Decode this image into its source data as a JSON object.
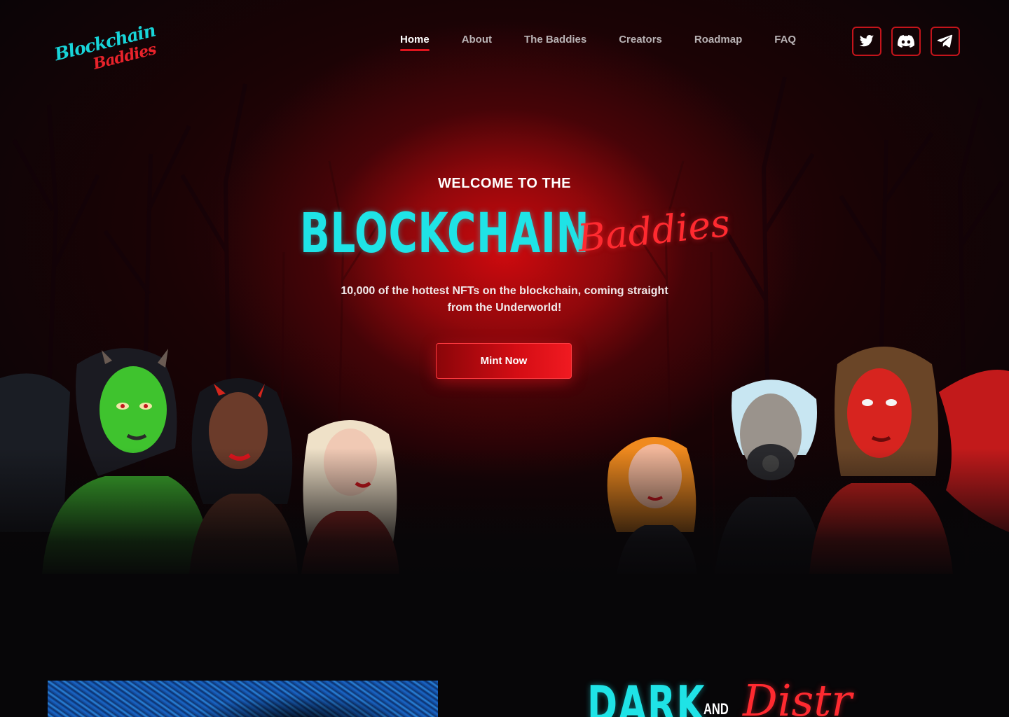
{
  "brand": {
    "logo_line1": "Blockchain",
    "logo_line2": "Baddies"
  },
  "nav": {
    "items": [
      {
        "label": "Home",
        "active": true
      },
      {
        "label": "About",
        "active": false
      },
      {
        "label": "The Baddies",
        "active": false
      },
      {
        "label": "Creators",
        "active": false
      },
      {
        "label": "Roadmap",
        "active": false
      },
      {
        "label": "FAQ",
        "active": false
      }
    ]
  },
  "socials": [
    {
      "icon": "twitter-icon"
    },
    {
      "icon": "discord-icon"
    },
    {
      "icon": "telegram-icon"
    }
  ],
  "hero": {
    "welcome": "WELCOME TO THE",
    "title_main": "BLOCKCHAIN",
    "title_script": "Baddies",
    "subtitle": "10,000 of the hottest NFTs on the blockchain, coming straight from the Underworld!",
    "cta_label": "Mint Now"
  },
  "section2": {
    "heading_main": "DARK",
    "heading_and": "AND",
    "heading_script": "Distr"
  },
  "colors": {
    "accent_red": "#e0141d",
    "accent_cyan": "#1fe3e6",
    "background": "#070608"
  }
}
